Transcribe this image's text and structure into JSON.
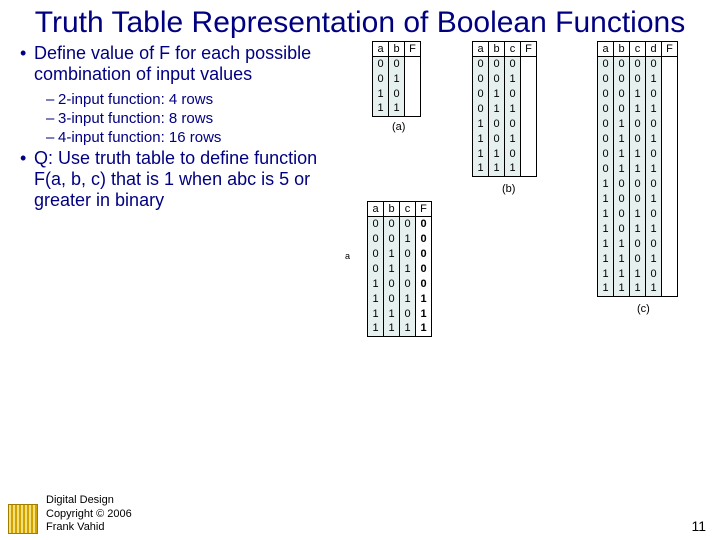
{
  "title": "Truth Table Representation of Boolean Functions",
  "bullets": {
    "b1": "Define value of F for each possible combination of input values",
    "s1": "2-input function: 4 rows",
    "s2": "3-input function: 8 rows",
    "s3": "4-input function: 16 rows",
    "b2": "Q: Use truth table to define function F(a, b, c) that is 1 when abc is 5 or greater in binary"
  },
  "tiny": "a",
  "tableA": {
    "h": [
      "a",
      "b",
      "F"
    ],
    "rows": [
      [
        "0",
        "0",
        ""
      ],
      [
        "0",
        "1",
        ""
      ],
      [
        "1",
        "0",
        ""
      ],
      [
        "1",
        "1",
        ""
      ]
    ],
    "caption": "(a)"
  },
  "tableB": {
    "h": [
      "a",
      "b",
      "c",
      "F"
    ],
    "rows": [
      [
        "0",
        "0",
        "0",
        ""
      ],
      [
        "0",
        "0",
        "1",
        ""
      ],
      [
        "0",
        "1",
        "0",
        ""
      ],
      [
        "0",
        "1",
        "1",
        ""
      ],
      [
        "1",
        "0",
        "0",
        ""
      ],
      [
        "1",
        "0",
        "1",
        ""
      ],
      [
        "1",
        "1",
        "0",
        ""
      ],
      [
        "1",
        "1",
        "1",
        ""
      ]
    ],
    "caption": "(b)"
  },
  "tableC": {
    "h": [
      "a",
      "b",
      "c",
      "d",
      "F"
    ],
    "rows": [
      [
        "0",
        "0",
        "0",
        "0",
        ""
      ],
      [
        "0",
        "0",
        "0",
        "1",
        ""
      ],
      [
        "0",
        "0",
        "1",
        "0",
        ""
      ],
      [
        "0",
        "0",
        "1",
        "1",
        ""
      ],
      [
        "0",
        "1",
        "0",
        "0",
        ""
      ],
      [
        "0",
        "1",
        "0",
        "1",
        ""
      ],
      [
        "0",
        "1",
        "1",
        "0",
        ""
      ],
      [
        "0",
        "1",
        "1",
        "1",
        ""
      ],
      [
        "1",
        "0",
        "0",
        "0",
        ""
      ],
      [
        "1",
        "0",
        "0",
        "1",
        ""
      ],
      [
        "1",
        "0",
        "1",
        "0",
        ""
      ],
      [
        "1",
        "0",
        "1",
        "1",
        ""
      ],
      [
        "1",
        "1",
        "0",
        "0",
        ""
      ],
      [
        "1",
        "1",
        "0",
        "1",
        ""
      ],
      [
        "1",
        "1",
        "1",
        "0",
        ""
      ],
      [
        "1",
        "1",
        "1",
        "1",
        ""
      ]
    ],
    "caption": "(c)"
  },
  "tableQ": {
    "h": [
      "a",
      "b",
      "c",
      "F"
    ],
    "rows": [
      [
        "0",
        "0",
        "0",
        "0"
      ],
      [
        "0",
        "0",
        "1",
        "0"
      ],
      [
        "0",
        "1",
        "0",
        "0"
      ],
      [
        "0",
        "1",
        "1",
        "0"
      ],
      [
        "1",
        "0",
        "0",
        "0"
      ],
      [
        "1",
        "0",
        "1",
        "1"
      ],
      [
        "1",
        "1",
        "0",
        "1"
      ],
      [
        "1",
        "1",
        "1",
        "1"
      ]
    ]
  },
  "footer": {
    "l1": "Digital Design",
    "l2": "Copyright © 2006",
    "l3": "Frank Vahid",
    "page": "11"
  }
}
